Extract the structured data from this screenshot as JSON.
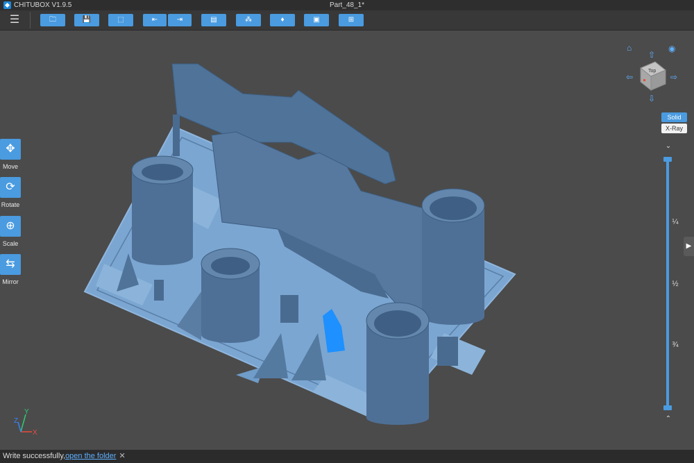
{
  "titlebar": {
    "app_name": "CHITUBOX V1.9.5",
    "document": "Part_48_1*"
  },
  "toolbar": {
    "menu_icon": "hamburger-icon",
    "buttons": [
      {
        "name": "open-file-button",
        "icon": "folder-icon",
        "glyph": "🗀"
      },
      {
        "name": "save-button",
        "icon": "save-icon",
        "glyph": "💾"
      },
      {
        "name": "select-all-button",
        "icon": "select-icon",
        "glyph": "⬚"
      },
      {
        "name": "import-button",
        "icon": "import-icon",
        "glyph": "⇤"
      },
      {
        "name": "export-button",
        "icon": "export-icon",
        "glyph": "⇥"
      },
      {
        "name": "settings-button",
        "icon": "settings-icon",
        "glyph": "▤"
      },
      {
        "name": "auto-layout-button",
        "icon": "layout-icon",
        "glyph": "⁂"
      },
      {
        "name": "support-button",
        "icon": "support-icon",
        "glyph": "♦"
      },
      {
        "name": "hollow-button",
        "icon": "hollow-icon",
        "glyph": "▣"
      },
      {
        "name": "slice-button",
        "icon": "slice-icon",
        "glyph": "⊞"
      }
    ]
  },
  "left_tools": [
    {
      "label": "Move",
      "icon": "move-icon",
      "glyph": "✥"
    },
    {
      "label": "Rotate",
      "icon": "rotate-icon",
      "glyph": "⟳"
    },
    {
      "label": "Scale",
      "icon": "scale-icon",
      "glyph": "⊕"
    },
    {
      "label": "Mirror",
      "icon": "mirror-icon",
      "glyph": "⇆"
    }
  ],
  "view_cube": {
    "face_label": "Top"
  },
  "render_modes": {
    "solid": "Solid",
    "xray": "X-Ray",
    "active": "Solid"
  },
  "layer_slider": {
    "marks": [
      "¼",
      "½",
      "¾"
    ],
    "position": 0
  },
  "axes": {
    "x": "X",
    "y": "Y",
    "z": "Z"
  },
  "status": {
    "message": "Write successfully,",
    "link": "open the folder",
    "close": "✕"
  },
  "colors": {
    "accent": "#4a9be0",
    "model": "#4f7399",
    "plate": "#6f9cc8",
    "selected": "#1e90ff"
  }
}
